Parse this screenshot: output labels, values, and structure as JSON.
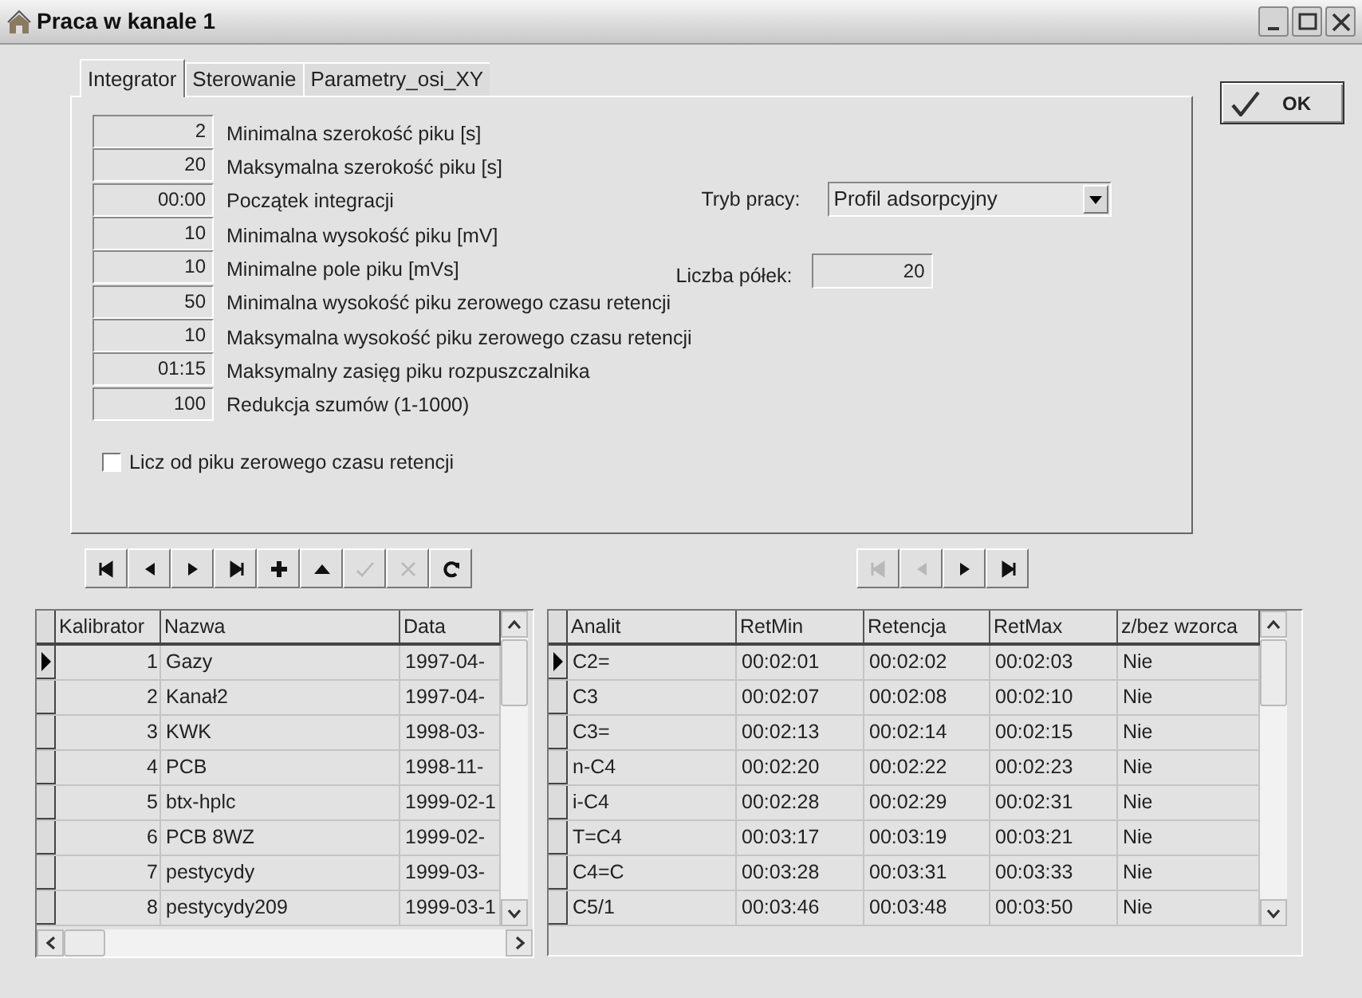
{
  "window": {
    "title": "Praca w kanale 1"
  },
  "tabs": [
    {
      "label": "Integrator",
      "selected": true
    },
    {
      "label": "Sterowanie",
      "selected": false
    },
    {
      "label": "Parametry_osi_XY",
      "selected": false
    }
  ],
  "parameters": [
    {
      "value": "2",
      "label": "Minimalna szerokość piku [s]"
    },
    {
      "value": "20",
      "label": "Maksymalna szerokość piku [s]"
    },
    {
      "value": "00:00",
      "label": "Początek integracji"
    },
    {
      "value": "10",
      "label": "Minimalna wysokość piku [mV]"
    },
    {
      "value": "10",
      "label": "Minimalne pole piku [mVs]"
    },
    {
      "value": "50",
      "label": "Minimalna wysokość piku zerowego czasu retencji"
    },
    {
      "value": "10",
      "label": "Maksymalna wysokość piku zerowego czasu retencji"
    },
    {
      "value": "01:15",
      "label": "Maksymalny zasięg piku rozpuszczalnika"
    },
    {
      "value": "100",
      "label": "Redukcja szumów (1-1000)"
    }
  ],
  "count_from_zero": {
    "label": "Licz od piku zerowego czasu retencji",
    "checked": false
  },
  "mode": {
    "label": "Tryb pracy:",
    "value": "Profil adsorpcyjny"
  },
  "shelves": {
    "label": "Liczba półek:",
    "value": "20"
  },
  "ok_button": {
    "label": "OK"
  },
  "calibrators": {
    "navigator": [
      {
        "kind": "first",
        "disabled": false
      },
      {
        "kind": "prior",
        "disabled": false
      },
      {
        "kind": "next",
        "disabled": false
      },
      {
        "kind": "last",
        "disabled": false
      },
      {
        "kind": "insert",
        "disabled": false
      },
      {
        "kind": "edit",
        "disabled": false
      },
      {
        "kind": "post",
        "disabled": true
      },
      {
        "kind": "cancel",
        "disabled": true
      },
      {
        "kind": "refresh",
        "disabled": false
      }
    ],
    "columns": [
      "Kalibrator",
      "Nazwa",
      "Data"
    ],
    "rows": [
      {
        "cells": [
          "1",
          "Gazy",
          "1997-04-"
        ],
        "selected": true
      },
      {
        "cells": [
          "2",
          "Kanał2",
          "1997-04-"
        ],
        "selected": false
      },
      {
        "cells": [
          "3",
          "KWK",
          "1998-03-"
        ],
        "selected": false
      },
      {
        "cells": [
          "4",
          "PCB",
          "1998-11-"
        ],
        "selected": false
      },
      {
        "cells": [
          "5",
          "btx-hplc",
          "1999-02-1"
        ],
        "selected": false
      },
      {
        "cells": [
          "6",
          "PCB 8WZ",
          "1999-02-"
        ],
        "selected": false
      },
      {
        "cells": [
          "7",
          "pestycydy",
          "1999-03-"
        ],
        "selected": false
      },
      {
        "cells": [
          "8",
          "pestycydy209",
          "1999-03-1"
        ],
        "selected": false
      }
    ]
  },
  "analytes": {
    "navigator": [
      {
        "kind": "first",
        "disabled": true
      },
      {
        "kind": "prior",
        "disabled": true
      },
      {
        "kind": "next",
        "disabled": false
      },
      {
        "kind": "last",
        "disabled": false
      }
    ],
    "columns": [
      "Analit",
      "RetMin",
      "Retencja",
      "RetMax",
      "z/bez wzorca"
    ],
    "rows": [
      {
        "cells": [
          "C2=",
          "00:02:01",
          "00:02:02",
          "00:02:03",
          "Nie"
        ],
        "selected": true
      },
      {
        "cells": [
          "C3",
          "00:02:07",
          "00:02:08",
          "00:02:10",
          "Nie"
        ],
        "selected": false
      },
      {
        "cells": [
          "C3=",
          "00:02:13",
          "00:02:14",
          "00:02:15",
          "Nie"
        ],
        "selected": false
      },
      {
        "cells": [
          "n-C4",
          "00:02:20",
          "00:02:22",
          "00:02:23",
          "Nie"
        ],
        "selected": false
      },
      {
        "cells": [
          "i-C4",
          "00:02:28",
          "00:02:29",
          "00:02:31",
          "Nie"
        ],
        "selected": false
      },
      {
        "cells": [
          "T=C4",
          "00:03:17",
          "00:03:19",
          "00:03:21",
          "Nie"
        ],
        "selected": false
      },
      {
        "cells": [
          "C4=C",
          "00:03:28",
          "00:03:31",
          "00:03:33",
          "Nie"
        ],
        "selected": false
      },
      {
        "cells": [
          "C5/1",
          "00:03:46",
          "00:03:48",
          "00:03:50",
          "Nie"
        ],
        "selected": false
      }
    ]
  }
}
